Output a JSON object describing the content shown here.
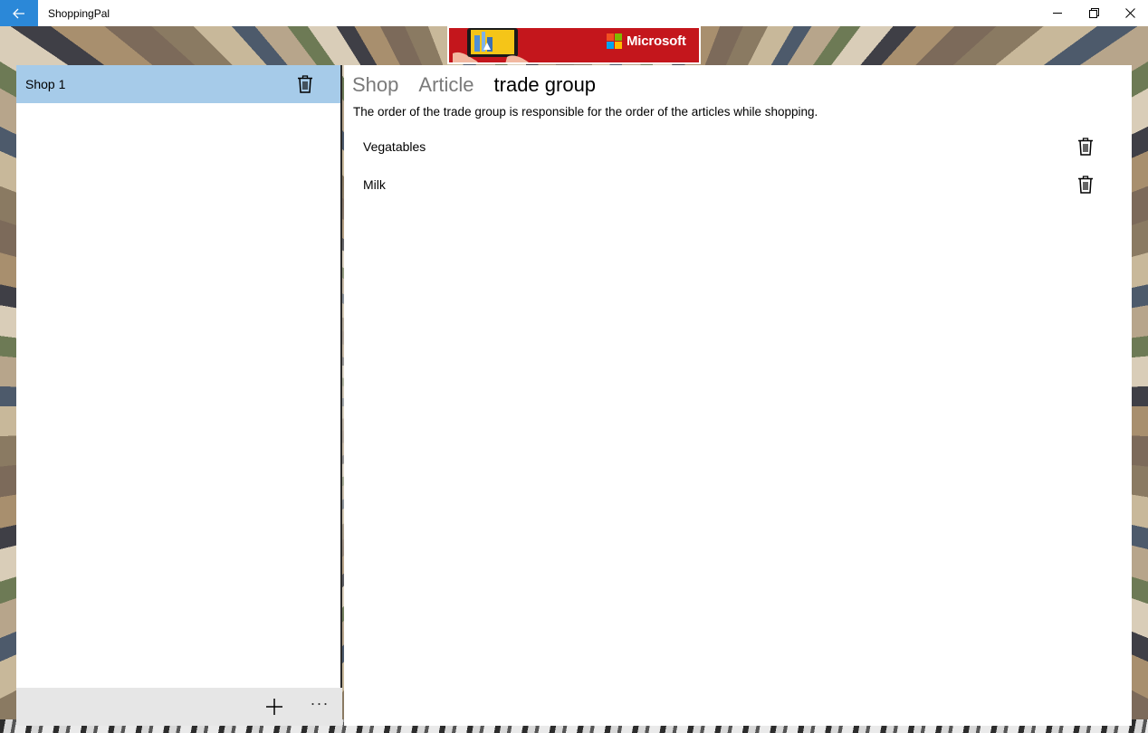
{
  "window": {
    "title": "ShoppingPal",
    "accent": "#2b88d8"
  },
  "ad": {
    "brand": "Microsoft",
    "background": "#c4161c"
  },
  "shops": {
    "items": [
      {
        "label": "Shop 1",
        "selected": true
      }
    ],
    "selected_color": "#a6cbe9"
  },
  "icons": {
    "back": "back-arrow-icon",
    "minimize": "minimize-icon",
    "restore": "restore-icon",
    "close": "close-icon",
    "delete": "trash-icon",
    "add": "add-icon",
    "more": "more-icon"
  },
  "pivot": {
    "tabs": [
      {
        "label": "Shop",
        "active": false
      },
      {
        "label": "Article",
        "active": false
      },
      {
        "label": "trade group",
        "active": true
      }
    ]
  },
  "trade_group": {
    "description": "The order of the trade group is responsible for the order of the articles while shopping.",
    "items": [
      {
        "label": "Vegatables"
      },
      {
        "label": "Milk"
      }
    ]
  },
  "command_bar": {
    "more_glyph": "···"
  }
}
